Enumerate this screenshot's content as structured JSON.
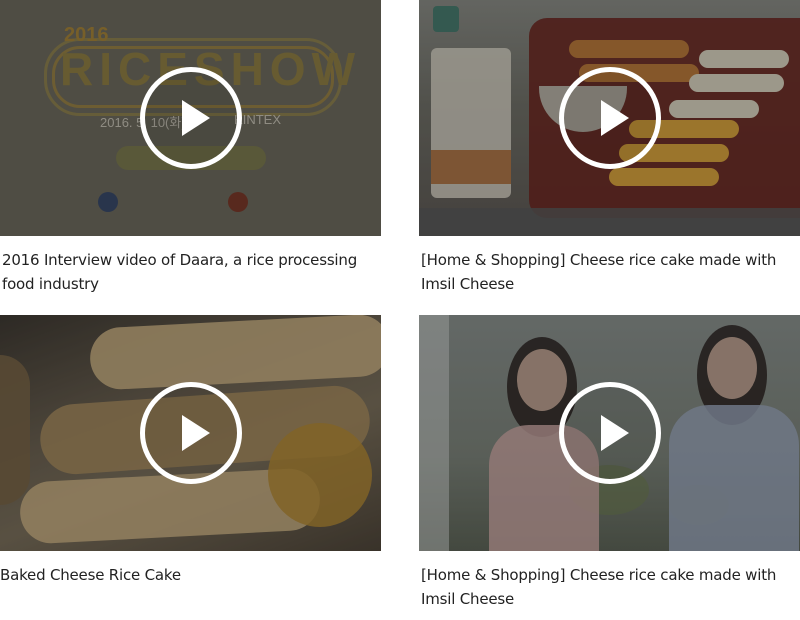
{
  "videos": [
    {
      "caption": "2016 Interview video of Daara, a rice processing food industry",
      "thumb_text": {
        "year": "2016",
        "title": "RICESHOW",
        "date": "2016. 5. 10(화)",
        "venue": "KINTEX"
      }
    },
    {
      "caption": "[Home & Shopping] Cheese rice cake made with Imsil Cheese"
    },
    {
      "caption": "Baked Cheese Rice Cake"
    },
    {
      "caption": "[Home & Shopping] Cheese rice cake made with Imsil Cheese"
    }
  ],
  "play_icon": "play-circle-icon",
  "colors": {
    "caption_text": "#222222",
    "play_icon": "#ffffff"
  }
}
